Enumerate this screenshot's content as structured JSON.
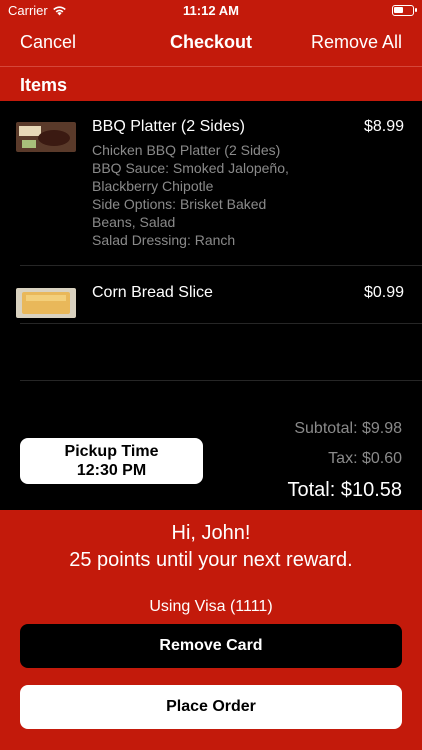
{
  "status_bar": {
    "carrier": "Carrier",
    "time": "11:12 AM"
  },
  "nav": {
    "cancel_label": "Cancel",
    "title": "Checkout",
    "remove_all_label": "Remove All"
  },
  "items_header": "Items",
  "items": [
    {
      "name": "BBQ Platter (2 Sides)",
      "price": "$8.99",
      "options": [
        "Chicken BBQ Platter (2 Sides)",
        "BBQ Sauce: Smoked Jalopeño,",
        "Blackberry Chipotle",
        "Side Options: Brisket Baked",
        "Beans, Salad",
        "Salad Dressing: Ranch"
      ],
      "thumb_icon": "bbq-platter-photo"
    },
    {
      "name": "Corn Bread Slice",
      "price": "$0.99",
      "options": [],
      "thumb_icon": "corn-bread-photo"
    }
  ],
  "totals": {
    "subtotal": "Subtotal: $9.98",
    "tax": "Tax: $0.60",
    "total": "Total: $10.58"
  },
  "pickup": {
    "label": "Pickup Time",
    "time": "12:30 PM"
  },
  "rewards": {
    "greeting": "Hi, John!",
    "points_message": "25 points until your next reward."
  },
  "payment": {
    "using": "Using Visa (1111)",
    "remove_card_label": "Remove Card",
    "place_order_label": "Place Order"
  },
  "colors": {
    "brand_red": "#c31a0b",
    "list_bg": "#000000",
    "muted_text": "#8a8a8a"
  }
}
